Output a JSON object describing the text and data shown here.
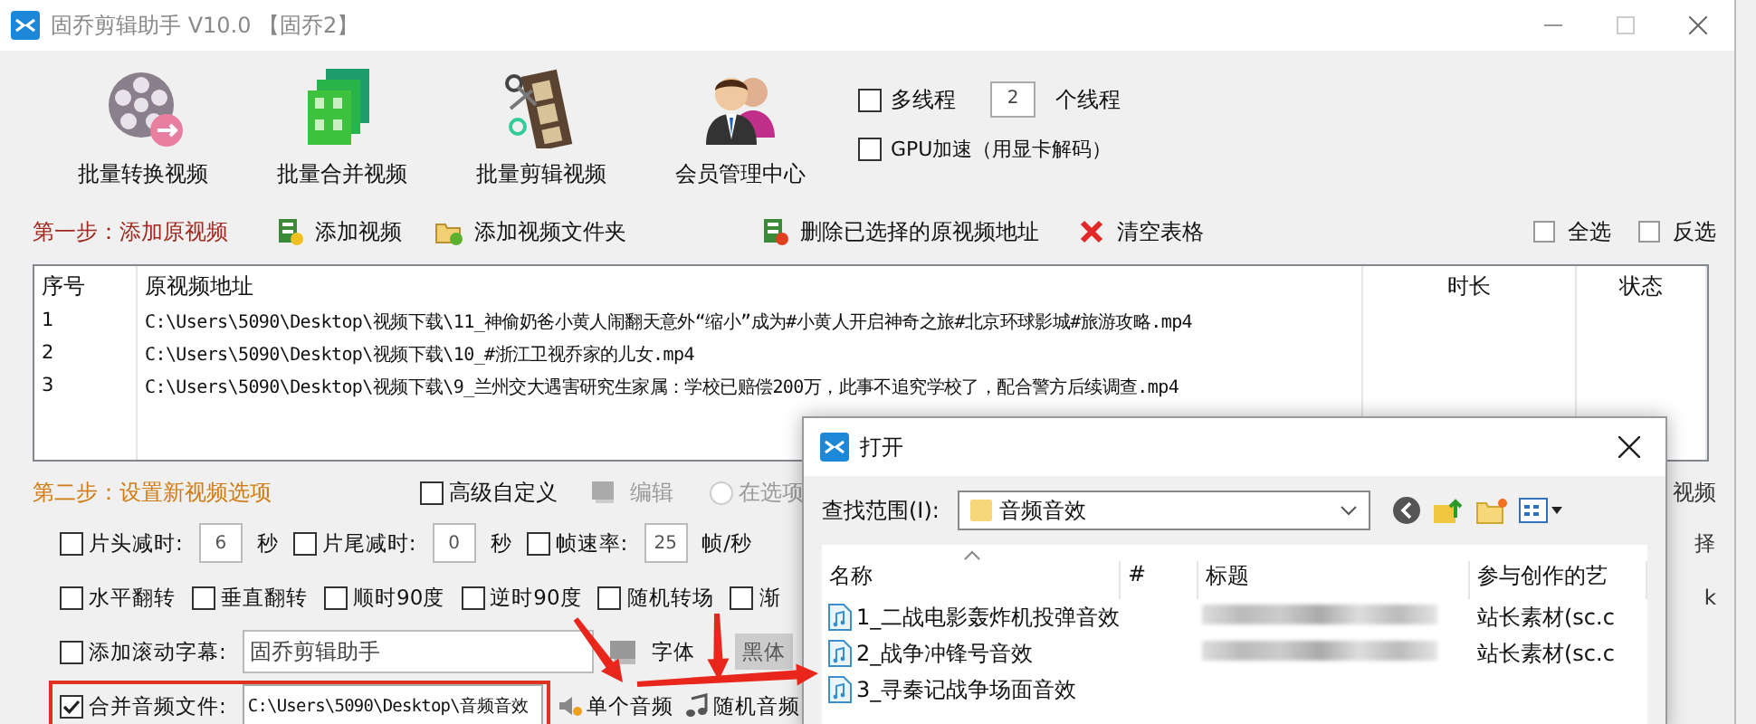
{
  "window": {
    "title": "固乔剪辑助手 V10.0 【固乔2】"
  },
  "toolbar": {
    "tools": [
      {
        "label": "批量转换视频",
        "kind": "convert"
      },
      {
        "label": "批量合并视频",
        "kind": "merge"
      },
      {
        "label": "批量剪辑视频",
        "kind": "cut"
      },
      {
        "label": "会员管理中心",
        "kind": "members"
      }
    ],
    "threads": {
      "label": "多线程",
      "checked": false,
      "value": "2",
      "unit": "个线程"
    },
    "gpu": {
      "label": "GPU加速（用显卡解码）",
      "checked": false
    }
  },
  "step1": {
    "title": "第一步：添加原视频",
    "actions": [
      {
        "label": "添加视频",
        "kind": "add-file"
      },
      {
        "label": "添加视频文件夹",
        "kind": "add-folder"
      },
      {
        "label": "删除已选择的原视频地址",
        "kind": "delete"
      },
      {
        "label": "清空表格",
        "kind": "clear"
      }
    ],
    "select": [
      {
        "label": "全选"
      },
      {
        "label": "反选"
      }
    ]
  },
  "table": {
    "columns": [
      "序号",
      "原视频地址",
      "时长",
      "状态"
    ],
    "rows": [
      [
        "1",
        "C:\\Users\\5090\\Desktop\\视频下载\\11_神偷奶爸小黄人闹翻天意外“缩小”成为#小黄人开启神奇之旅#北京环球影城#旅游攻略.mp4"
      ],
      [
        "2",
        "C:\\Users\\5090\\Desktop\\视频下载\\10_#浙江卫视乔家的儿女.mp4"
      ],
      [
        "3",
        "C:\\Users\\5090\\Desktop\\视频下载\\9_兰州交大遇害研究生家属：学校已赔偿200万，此事不追究学校了，配合警方后续调查.mp4"
      ]
    ]
  },
  "step2": {
    "title": "第二步：设置新视频选项",
    "advanced": {
      "label": "高级自定义",
      "checked": false
    },
    "edit": {
      "label": "编辑",
      "disabled": true
    },
    "radio": {
      "label": "在选项",
      "selected": false
    },
    "right_text": "视频"
  },
  "option_rows": [
    {
      "items": [
        {
          "kind": "check",
          "label": "片头减时:",
          "checked": false
        },
        {
          "kind": "field",
          "value": "6"
        },
        {
          "kind": "unit",
          "label": "秒"
        },
        {
          "kind": "check",
          "label": "片尾减时:",
          "checked": false
        },
        {
          "kind": "field",
          "value": "0"
        },
        {
          "kind": "unit",
          "label": "秒"
        },
        {
          "kind": "check",
          "label": "帧速率:",
          "checked": false
        },
        {
          "kind": "field",
          "value": "25"
        },
        {
          "kind": "unit",
          "label": "帧/秒"
        }
      ],
      "right_text": "择"
    },
    {
      "items": [
        {
          "kind": "check",
          "label": "水平翻转",
          "checked": false
        },
        {
          "kind": "check",
          "label": "垂直翻转",
          "checked": false
        },
        {
          "kind": "check",
          "label": "顺时90度",
          "checked": false
        },
        {
          "kind": "check",
          "label": "逆时90度",
          "checked": false
        },
        {
          "kind": "check",
          "label": "随机转场",
          "checked": false
        },
        {
          "kind": "check",
          "label": "渐",
          "checked": false
        }
      ],
      "right_text": "k"
    },
    {
      "items": [
        {
          "kind": "check",
          "label": "添加滚动字幕:",
          "checked": false
        },
        {
          "kind": "textfield",
          "value": "固乔剪辑助手"
        },
        {
          "kind": "font-icon"
        },
        {
          "kind": "unit",
          "label": "字体"
        },
        {
          "kind": "dropdown",
          "value": "黑体"
        }
      ]
    },
    {
      "items": [
        {
          "kind": "check",
          "label": "合并音频文件:",
          "checked": true,
          "highlighted": true
        },
        {
          "kind": "pathfield",
          "value": "C:\\Users\\5090\\Desktop\\音频音效",
          "highlighted": true
        },
        {
          "kind": "audio-button",
          "label": "单个音频"
        },
        {
          "kind": "audio-button",
          "label": "随机音频"
        }
      ]
    }
  ],
  "dialog": {
    "title": "打开",
    "look_in_label": "查找范围(I):",
    "folder": "音频音效",
    "columns": [
      "名称",
      "#",
      "标题",
      "参与创作的艺"
    ],
    "files": [
      {
        "name": "1_二战电影轰炸机投弹音效",
        "title_blurred": true,
        "artist": "站长素材(sc.c"
      },
      {
        "name": "2_战争冲锋号音效",
        "title_blurred": true,
        "artist": "站长素材(sc.c"
      },
      {
        "name": "3_寻秦记战争场面音效",
        "title_blurred": false
      }
    ]
  }
}
